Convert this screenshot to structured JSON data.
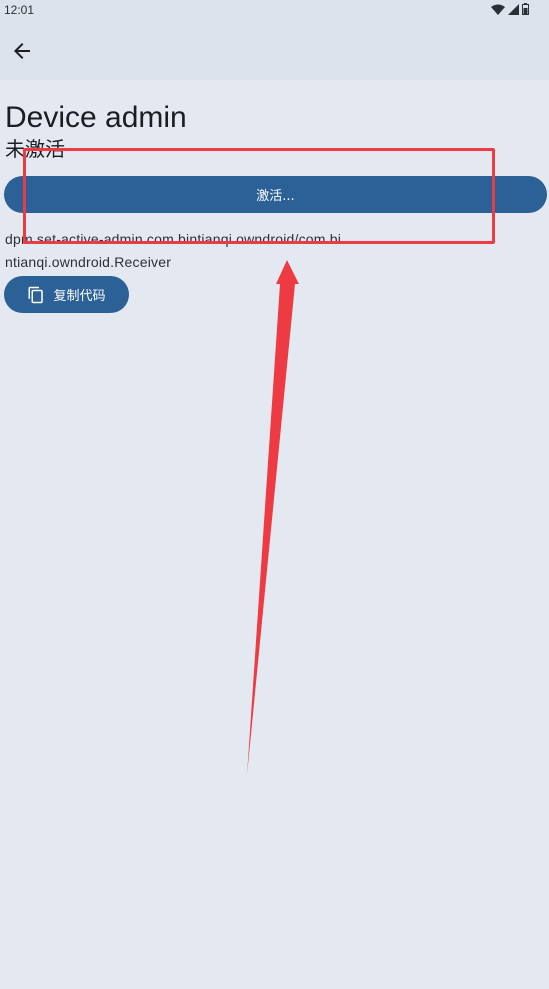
{
  "status_bar": {
    "time": "12:01",
    "icons": [
      "wifi-icon",
      "signal-icon",
      "battery-icon"
    ]
  },
  "app_bar": {
    "back_icon": "arrow-left-icon"
  },
  "page": {
    "title": "Device admin",
    "status": "未激活",
    "activate_button_label": "激活...",
    "command": "dpm set-active-admin com.bintianqi.owndroid/com.bintianqi.owndroid.Receiver",
    "copy_button_label": "复制代码",
    "copy_icon": "copy-icon"
  },
  "colors": {
    "background": "#e4e9f1",
    "app_bar": "#dde3ec",
    "primary": "#2c6198",
    "annotation": "#ee3b43"
  }
}
